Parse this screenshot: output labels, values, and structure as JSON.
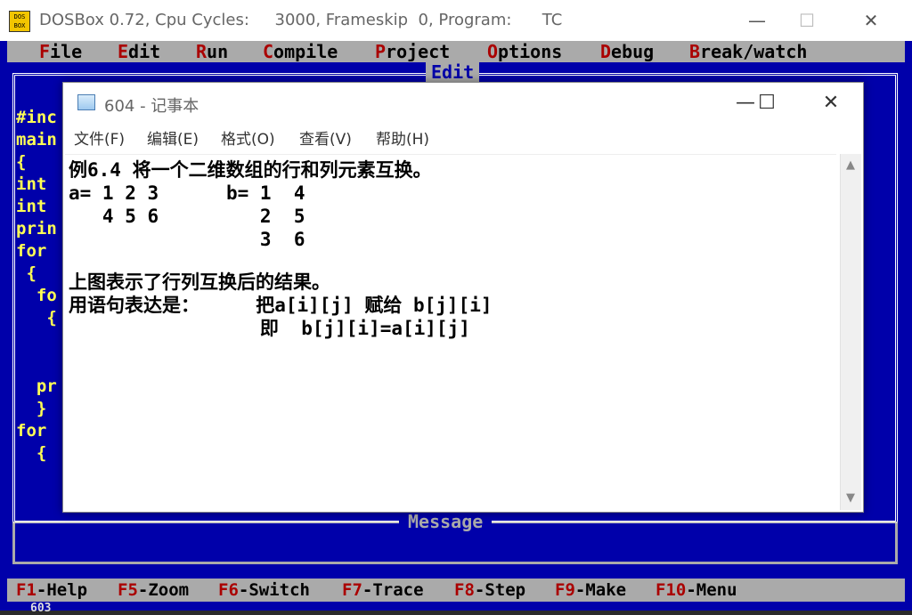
{
  "dosbox": {
    "title": "DOSBox 0.72, Cpu Cycles:     3000, Frameskip  0, Program:      TC",
    "icon_text": "DOS\nBOX",
    "controls": {
      "minimize": "—",
      "maximize": "☐",
      "close": "✕"
    }
  },
  "menu": {
    "items": [
      {
        "hot": "F",
        "rest": "ile"
      },
      {
        "hot": "E",
        "rest": "dit"
      },
      {
        "hot": "R",
        "rest": "un"
      },
      {
        "hot": "C",
        "rest": "ompile"
      },
      {
        "hot": "P",
        "rest": "roject"
      },
      {
        "hot": "O",
        "rest": "ptions"
      },
      {
        "hot": "D",
        "rest": "ebug"
      },
      {
        "hot": "B",
        "rest": "reak/watch"
      }
    ]
  },
  "editor": {
    "title": "Edit",
    "code_lines": [
      "#inc",
      "main",
      "{",
      "int",
      "int",
      "prin",
      "for",
      " {",
      "  fo",
      "   {",
      "",
      "",
      "  pr",
      "  }",
      "for",
      "  {"
    ]
  },
  "message": {
    "title": "Message"
  },
  "status_bar": {
    "keys": [
      {
        "key": "F1",
        "label": "-Help"
      },
      {
        "key": "F5",
        "label": "-Zoom"
      },
      {
        "key": "F6",
        "label": "-Switch"
      },
      {
        "key": "F7",
        "label": "-Trace"
      },
      {
        "key": "F8",
        "label": "-Step"
      },
      {
        "key": "F9",
        "label": "-Make"
      },
      {
        "key": "F10",
        "label": "-Menu"
      }
    ],
    "bottom_text": "603"
  },
  "notepad": {
    "title": "604 - 记事本",
    "controls": {
      "minimize": "—",
      "maximize": "☐",
      "close": "✕"
    },
    "menu": [
      "文件(F)",
      "编辑(E)",
      "格式(O)",
      "查看(V)",
      "帮助(H)"
    ],
    "lines": [
      "例6.4 将一个二维数组的行和列元素互换。",
      "a= 1 2 3      b= 1  4",
      "   4 5 6         2  5",
      "                 3  6",
      "",
      "上图表示了行列互换后的结果。",
      "用语句表达是：     把a[i][j] 赋给 b[j][i]",
      "                 即  b[j][i]=a[i][j]"
    ],
    "scroll_up": "▲",
    "scroll_down": "▼"
  }
}
